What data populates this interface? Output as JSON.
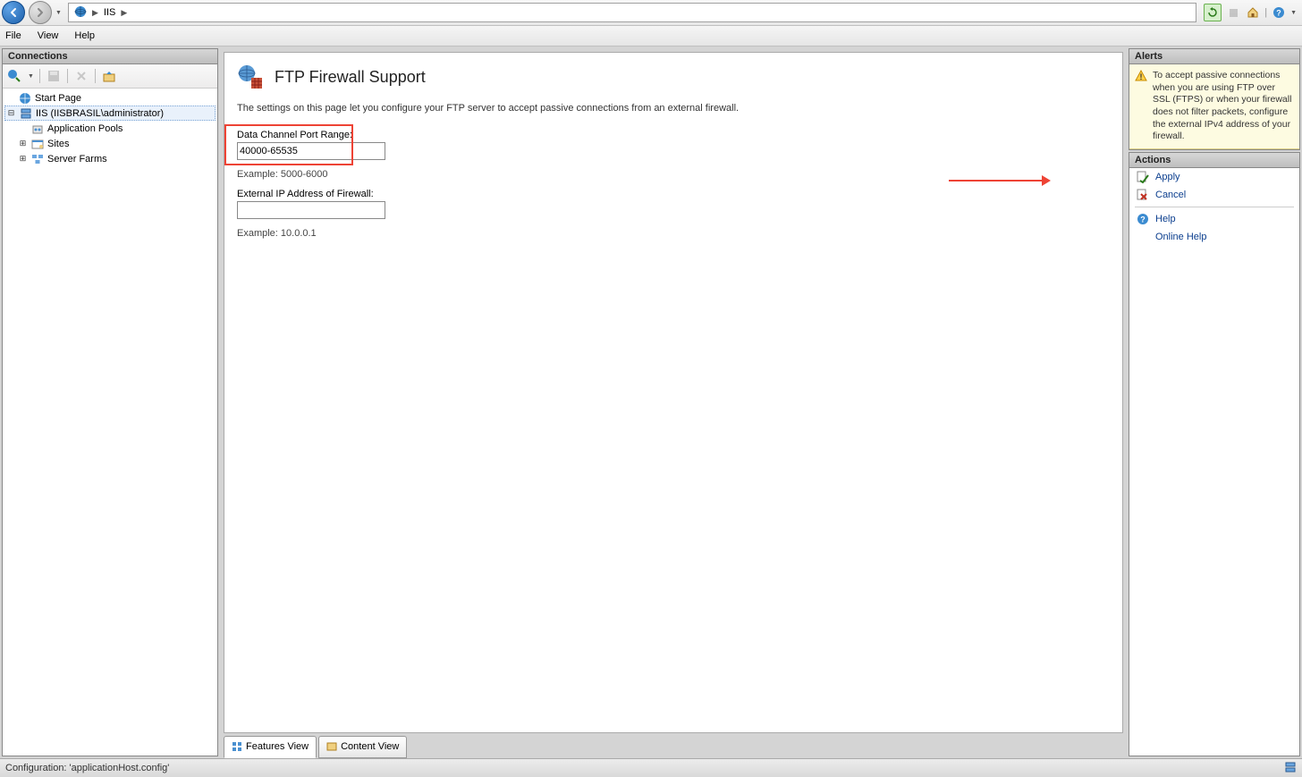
{
  "breadcrumb": {
    "icon": "iis",
    "item": "IIS"
  },
  "menu": {
    "file": "File",
    "view": "View",
    "help": "Help"
  },
  "connections": {
    "header": "Connections",
    "toolbar": [
      "globe-icon",
      "save-icon",
      "page-icon",
      "refresh-icon"
    ],
    "tree": {
      "start": "Start Page",
      "server": "IIS (IISBRASIL\\administrator)",
      "app_pools": "Application Pools",
      "sites": "Sites",
      "server_farms": "Server Farms"
    }
  },
  "center": {
    "title": "FTP Firewall Support",
    "description": "The settings on this page let you configure your FTP server to accept passive connections from an external firewall.",
    "port_label": "Data Channel Port Range:",
    "port_value": "40000-65535",
    "port_example": "Example: 5000-6000",
    "ip_label": "External IP Address of Firewall:",
    "ip_value": "",
    "ip_example": "Example: 10.0.0.1"
  },
  "tabs": {
    "features": "Features View",
    "content": "Content View"
  },
  "alerts": {
    "header": "Alerts",
    "text": "To accept passive connections when you are using FTP over SSL (FTPS) or when your firewall does not filter packets, configure the external IPv4 address of your firewall."
  },
  "actions": {
    "header": "Actions",
    "apply": "Apply",
    "cancel": "Cancel",
    "help": "Help",
    "online_help": "Online Help"
  },
  "statusbar": "Configuration: 'applicationHost.config'"
}
